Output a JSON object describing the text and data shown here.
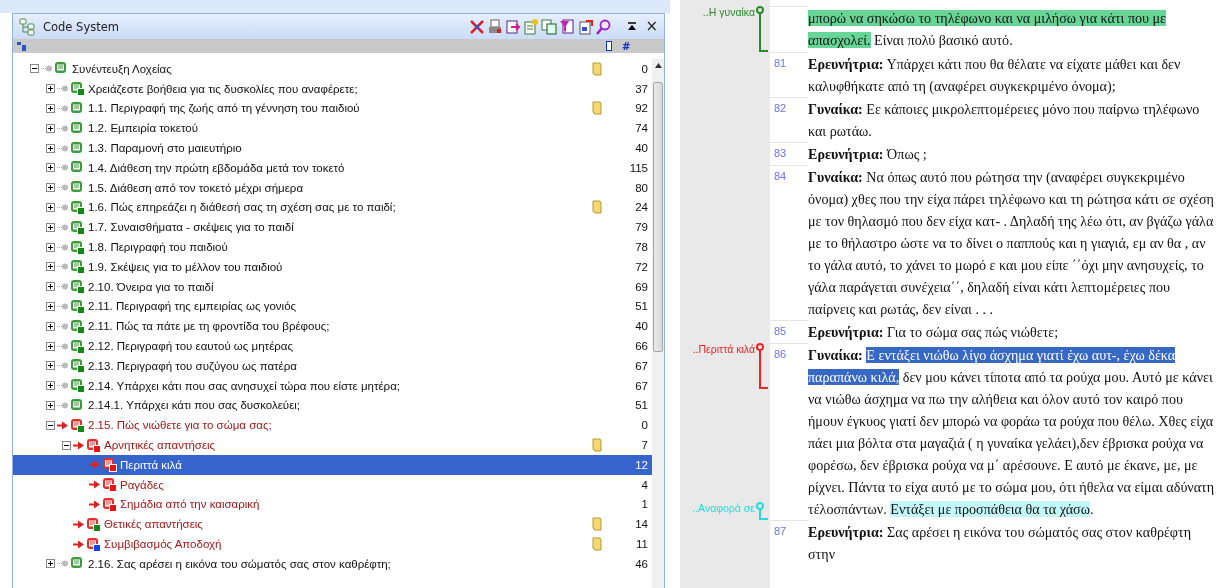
{
  "panel": {
    "title": "Code System",
    "close": "×",
    "columns": {
      "count": "#"
    }
  },
  "tree": [
    {
      "label": "Συνέντευξη Λοχείας",
      "count": "0",
      "memo": true,
      "color": "#3d9a3d",
      "active": false,
      "selected": false,
      "expanded": true,
      "children": [
        {
          "label": "Χρειάζεστε βοήθεια για τις δυσκολίες που αναφέρετε;",
          "count": "37",
          "memo": false,
          "color": "#3d9a3d",
          "badge": {
            "color": "#118a11"
          },
          "active": false,
          "selected": false,
          "expanded": false
        },
        {
          "label": "1.1. Περιγραφή της ζωής από τη γέννηση του παιδιού",
          "count": "92",
          "memo": true,
          "color": "#3d9a3d",
          "active": false,
          "selected": false,
          "expanded": false
        },
        {
          "label": "1.2. Εμπειρία τοκετού",
          "count": "74",
          "memo": false,
          "color": "#3d9a3d",
          "active": false,
          "selected": false,
          "expanded": false
        },
        {
          "label": "1.3. Παραμονή στο μαιευτήριο",
          "count": "40",
          "memo": false,
          "color": "#3d9a3d",
          "active": false,
          "selected": false,
          "expanded": false
        },
        {
          "label": "1.4. Διάθεση την πρώτη εβδομάδα μετά τον τοκετό",
          "count": "115",
          "memo": false,
          "color": "#3d9a3d",
          "active": false,
          "selected": false,
          "expanded": false
        },
        {
          "label": "1.5. Διάθεση από τον τοκετό μέχρι σήμερα",
          "count": "80",
          "memo": false,
          "color": "#3d9a3d",
          "active": false,
          "selected": false,
          "expanded": false
        },
        {
          "label": "1.6. Πώς επηρεάζει η διάθεσή σας τη σχέση σας με το παιδί;",
          "count": "24",
          "memo": true,
          "color": "#3d9a3d",
          "badge": {
            "color": "#118a11"
          },
          "active": false,
          "selected": false,
          "expanded": false
        },
        {
          "label": "1.7. Συναισθήματα - σκέψεις για το παιδί",
          "count": "79",
          "memo": false,
          "color": "#3d9a3d",
          "badge": {
            "color": "#118a11"
          },
          "active": false,
          "selected": false,
          "expanded": false
        },
        {
          "label": "1.8. Περιγραφή του παιδιού",
          "count": "78",
          "memo": false,
          "color": "#3d9a3d",
          "badge": {
            "color": "#118a11"
          },
          "active": false,
          "selected": false,
          "expanded": false
        },
        {
          "label": "1.9. Σκέψεις για το μέλλον του παιδιού",
          "count": "72",
          "memo": false,
          "color": "#3d9a3d",
          "badge": {
            "color": "#118a11"
          },
          "active": false,
          "selected": false,
          "expanded": false
        },
        {
          "label": "2.10. Όνειρα για το παιδί",
          "count": "69",
          "memo": false,
          "color": "#3d9a3d",
          "badge": {
            "color": "#118a11"
          },
          "active": false,
          "selected": false,
          "expanded": false
        },
        {
          "label": "2.11. Περιγραφή της εμπειρίας ως γονιός",
          "count": "51",
          "memo": false,
          "color": "#3d9a3d",
          "badge": {
            "color": "#118a11"
          },
          "active": false,
          "selected": false,
          "expanded": false
        },
        {
          "label": "2.11. Πώς τα πάτε με τη φροντίδα του βρέφους;",
          "count": "40",
          "memo": false,
          "color": "#3d9a3d",
          "badge": {
            "color": "#118a11"
          },
          "active": false,
          "selected": false,
          "expanded": false
        },
        {
          "label": "2.12. Περιγραφή του εαυτού ως μητέρας",
          "count": "66",
          "memo": false,
          "color": "#3d9a3d",
          "badge": {
            "color": "#118a11"
          },
          "active": false,
          "selected": false,
          "expanded": false
        },
        {
          "label": "2.13. Περιγραφή του συζύγου ως πατέρα",
          "count": "67",
          "memo": false,
          "color": "#3d9a3d",
          "badge": {
            "color": "#118a11"
          },
          "active": false,
          "selected": false,
          "expanded": false
        },
        {
          "label": "2.14. Υπάρχει κάτι που σας ανησυχεί τώρα που είστε μητέρα;",
          "count": "67",
          "memo": false,
          "color": "#3d9a3d",
          "badge": {
            "color": "#118a11"
          },
          "active": false,
          "selected": false,
          "expanded": false
        },
        {
          "label": "2.14.1. Υπάρχει κάτι που σας δυσκολεύει;",
          "count": "51",
          "memo": false,
          "color": "#3d9a3d",
          "active": false,
          "selected": false,
          "expanded": false
        },
        {
          "label": "2.15. Πώς νιώθετε για το σώμα σας;",
          "count": "0",
          "memo": false,
          "color": "#e0302a",
          "badge": {
            "color": "#118a11"
          },
          "active": true,
          "selected": false,
          "expanded": true,
          "children": [
            {
              "label": "Αρνητικές απαντήσεις",
              "count": "7",
              "memo": true,
              "color": "#e0302a",
              "badge": {
                "color": "#ee1111"
              },
              "active": true,
              "selected": false,
              "expanded": true,
              "children": [
                {
                  "label": "Περιττά κιλά",
                  "count": "12",
                  "memo": false,
                  "color": "#e0302a",
                  "badge": {
                    "color": "#ee1111"
                  },
                  "active": true,
                  "selected": true
                },
                {
                  "label": "Ραγάδες",
                  "count": "4",
                  "memo": false,
                  "color": "#e0302a",
                  "badge": {
                    "color": "#ee1111"
                  },
                  "active": true,
                  "selected": false
                },
                {
                  "label": "Σημάδια από την καισαρική",
                  "count": "1",
                  "memo": false,
                  "color": "#e0302a",
                  "badge": {
                    "color": "#ee1111"
                  },
                  "active": true,
                  "selected": false
                }
              ]
            },
            {
              "label": "Θετικές απαντήσεις",
              "count": "14",
              "memo": true,
              "color": "#e0302a",
              "badge": {
                "color": "#118a11"
              },
              "active": true,
              "selected": false
            },
            {
              "label": "Συμβιβασμός Αποδοχή",
              "count": "11",
              "memo": true,
              "color": "#e0302a",
              "badge": {
                "color": "#1144ee"
              },
              "active": true,
              "selected": false
            }
          ]
        },
        {
          "label": "2.16. Σας αρέσει η εικόνα του σώματός σας στον καθρέφτη;",
          "count": "46",
          "memo": false,
          "color": "#3d9a3d",
          "active": false,
          "selected": false,
          "expanded": false
        }
      ]
    }
  ],
  "document": {
    "paragraphs": [
      {
        "codes": [
          {
            "label": "..Η γυναίκα",
            "color": "#2a8a2a",
            "kind": "span"
          }
        ],
        "segments": [
          {
            "text": "μπορώ να σηκώσω το τηλέφωνο και να μιλήσω για κάτι που με απασχολεί.",
            "highlight": {
              "color": "#66d596"
            }
          },
          {
            "text": " Είναι πολύ βασικό αυτό."
          }
        ]
      },
      {
        "number": "81",
        "segments": [
          {
            "text": "Ερευνήτρια:",
            "bold": true
          },
          {
            "text": " Υπάρχει κάτι που θα θέλατε να είχατε μάθει και δεν καλυφθήκατε από τη (αναφέρει συγκεκριμένο  όνομα);"
          }
        ]
      },
      {
        "number": "82",
        "segments": [
          {
            "text": "Γυναίκα:",
            "bold": true
          },
          {
            "text": " Εε κάποιες μικρολεπτομέρειες μόνο που παίρνω τηλέφωνο και ρωτάω."
          }
        ]
      },
      {
        "number": "83",
        "segments": [
          {
            "text": "Ερευνήτρια:",
            "bold": true
          },
          {
            "text": " Όπως ;"
          }
        ]
      },
      {
        "number": "84",
        "segments": [
          {
            "text": "Γυναίκα:",
            "bold": true
          },
          {
            "text": " Να όπως αυτό που ρώτησα την (αναφέρει συγκεκριμένο όνομα) χθες που την είχα πάρει τηλέφωνο και τη ρώτησα κάτι σε σχέση με τον θηλασμό που δεν είχα κατ- . Δηλαδή της λέω ότι, αν βγάζω γάλα με το θήλαστρο ώστε να το δίνει ο παππούς και η γιαγιά, εμ αν θα , αν το γάλα αυτό, το χάνει το μωρό ε και μου είπε ΄΄όχι μην ανησυχείς, το γάλα παράγεται συνέχεια΄΄, δηλαδή είναι κάτι λεπτομέρειες που παίρνεις και ρωτάς, δεν είναι . . ."
          }
        ]
      },
      {
        "number": "85",
        "segments": [
          {
            "text": "Ερευνήτρια:",
            "bold": true
          },
          {
            "text": " Για το σώμα σας πώς νιώθετε;"
          }
        ]
      },
      {
        "number": "86",
        "codes": [
          {
            "label": "..Περιττά κιλά",
            "color": "#ee2222",
            "kind": "span"
          },
          {
            "label": "..Αναφορά σε",
            "color": "#22dddd",
            "kind": "tail"
          }
        ],
        "segments": [
          {
            "text": "Γυναίκα: ",
            "bold": true
          },
          {
            "text": "Ε εντάξει νιώθω λίγο άσχημα γιατί έχω αυτ-, έχω δέκα παραπάνω κιλά,",
            "highlight": {
              "color": "#3768c4"
            }
          },
          {
            "text": " δεν μου κάνει τίποτα από τα ρούχα μου. Αυτό με κάνει να νιώθω άσχημα να πω την αλήθεια και όλον αυτό τον καιρό που ήμουν έγκυος γιατί δεν μπορώ να φοράω τα ρούχα που θέλω. Χθες είχα πάει μια βόλτα στα μαγαζιά ( η γυναίκα γελάει),δεν έβρισκα ρούχα να φορέσω, δεν έβρισκα ρούχα να μ΄ αρέσουνε. Ε αυτό με έκανε, με, με ρίχνει. Πάντα το είχα αυτό με το σώμα μου, ότι ήθελα να είμαι αδύνατη τέλοσπάντων. "
          },
          {
            "text": "Εντάξει με προσπάθεια θα τα χάσω",
            "highlight": {
              "color": "#c4f8f8"
            }
          },
          {
            "text": "."
          }
        ]
      },
      {
        "number": "87",
        "segments": [
          {
            "text": "Ερευνήτρια:",
            "bold": true
          },
          {
            "text": " Σας αρέσει η εικόνα του σώματός σας στον καθρέφτη στην"
          }
        ]
      }
    ]
  }
}
